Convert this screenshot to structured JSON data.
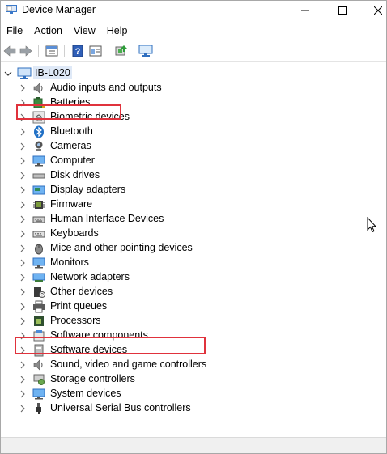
{
  "window": {
    "title": "Device Manager"
  },
  "menu": [
    "File",
    "Action",
    "View",
    "Help"
  ],
  "toolbar_icons": [
    "back-arrow-icon",
    "forward-arrow-icon",
    "properties-icon",
    "help-icon",
    "details-icon",
    "update-driver-icon",
    "monitor-scan-icon"
  ],
  "tree": {
    "root": "IB-L020",
    "items": [
      {
        "label": "Audio inputs and outputs",
        "icon": "speaker-icon"
      },
      {
        "label": "Batteries",
        "icon": "battery-icon"
      },
      {
        "label": "Biometric devices",
        "icon": "fingerprint-icon"
      },
      {
        "label": "Bluetooth",
        "icon": "bluetooth-icon"
      },
      {
        "label": "Cameras",
        "icon": "camera-icon"
      },
      {
        "label": "Computer",
        "icon": "computer-icon"
      },
      {
        "label": "Disk drives",
        "icon": "disk-drive-icon"
      },
      {
        "label": "Display adapters",
        "icon": "display-adapter-icon"
      },
      {
        "label": "Firmware",
        "icon": "chip-icon"
      },
      {
        "label": "Human Interface Devices",
        "icon": "hid-icon"
      },
      {
        "label": "Keyboards",
        "icon": "keyboard-icon"
      },
      {
        "label": "Mice and other pointing devices",
        "icon": "mouse-icon"
      },
      {
        "label": "Monitors",
        "icon": "monitor-icon"
      },
      {
        "label": "Network adapters",
        "icon": "network-adapter-icon"
      },
      {
        "label": "Other devices",
        "icon": "unknown-device-icon"
      },
      {
        "label": "Print queues",
        "icon": "printer-icon"
      },
      {
        "label": "Processors",
        "icon": "processor-icon"
      },
      {
        "label": "Software components",
        "icon": "software-component-icon"
      },
      {
        "label": "Software devices",
        "icon": "software-device-icon"
      },
      {
        "label": "Sound, video and game controllers",
        "icon": "sound-icon"
      },
      {
        "label": "Storage controllers",
        "icon": "storage-controller-icon"
      },
      {
        "label": "System devices",
        "icon": "system-devices-icon"
      },
      {
        "label": "Universal Serial Bus controllers",
        "icon": "usb-icon"
      }
    ]
  },
  "colors": {
    "highlight": "#e0323c",
    "selection": "#dfe9f7",
    "icon_blue": "#1f6fc5"
  }
}
